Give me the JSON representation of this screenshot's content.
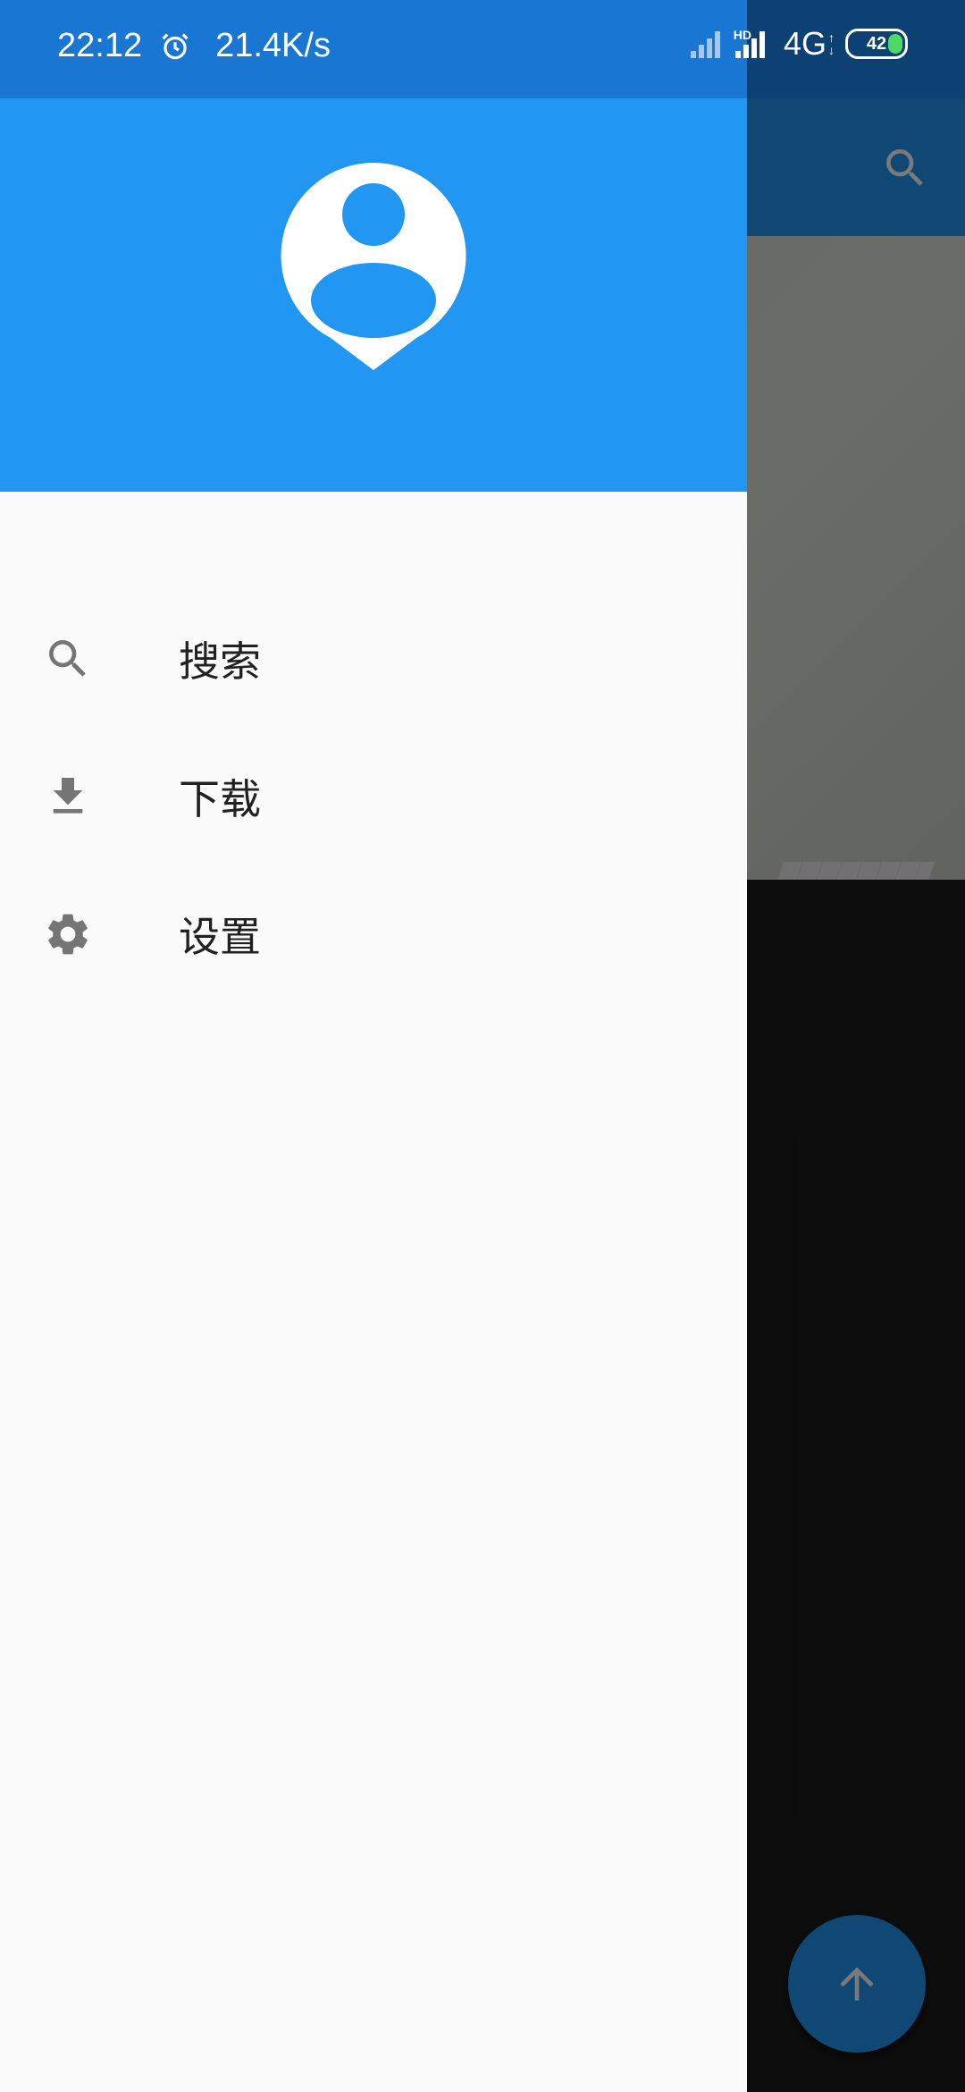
{
  "status_bar": {
    "time": "22:12",
    "network_speed": "21.4K/s",
    "hd": "HD",
    "network_type": "4G",
    "battery_level": "42",
    "icons": [
      "alarm-icon",
      "signal-icon",
      "battery-icon"
    ]
  },
  "drawer": {
    "header_icon": "account-avatar-icon",
    "items": [
      {
        "label": "搜索",
        "icon": "search-icon"
      },
      {
        "label": "下载",
        "icon": "download-icon"
      },
      {
        "label": "设置",
        "icon": "settings-gear-icon"
      }
    ]
  },
  "background_app": {
    "toolbar_icon": "search-icon",
    "fab_icon": "arrow-up-icon"
  },
  "colors": {
    "primary": "#2196F3",
    "primary_dark": "#1976D2",
    "drawer_bg": "#FAFAFA",
    "icon_gray": "#757575"
  }
}
